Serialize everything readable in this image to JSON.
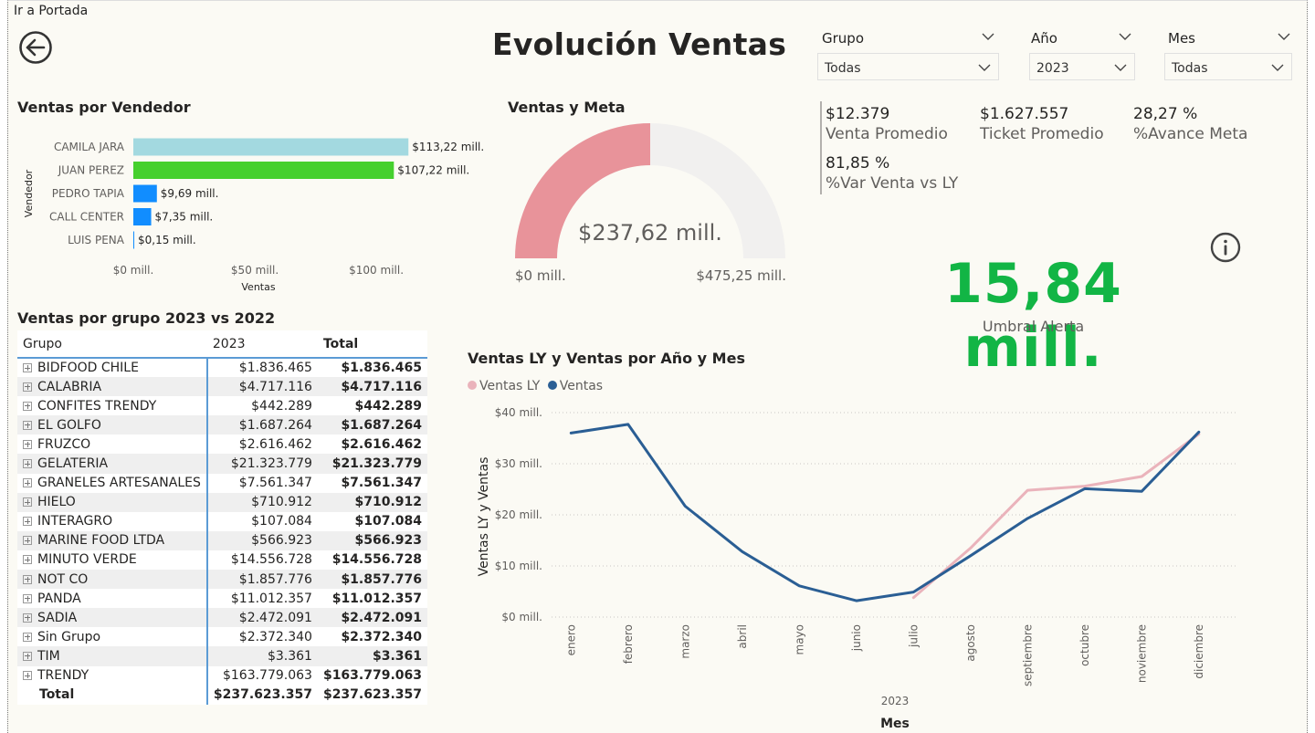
{
  "nav": {
    "portada_label": "Ir a Portada"
  },
  "page": {
    "title": "Evolución Ventas"
  },
  "slicers": [
    {
      "label": "Grupo",
      "value": "Todas"
    },
    {
      "label": "Año",
      "value": "2023"
    },
    {
      "label": "Mes",
      "value": "Todas"
    }
  ],
  "kpis": [
    {
      "value": "$12.379",
      "label": "Venta Promedio"
    },
    {
      "value": "$1.627.557",
      "label": "Ticket Promedio"
    },
    {
      "value": "28,27 %",
      "label": "%Avance Meta"
    },
    {
      "value": "81,85 %",
      "label": "%Var Venta vs LY"
    }
  ],
  "alert": {
    "value": "15,84 mill.",
    "label": "Umbral Alerta"
  },
  "colors": {
    "accent_green": "#12b545",
    "gauge_fill": "#e8939a",
    "gauge_bg": "#f1f0ef",
    "line_ventas": "#2a5e94",
    "line_ly": "#eab3bb"
  },
  "chart_data": [
    {
      "type": "bar",
      "orientation": "horizontal",
      "title": "Ventas por Vendedor",
      "xlabel": "Ventas",
      "ylabel": "Vendedor",
      "categories": [
        "CAMILA JARA",
        "JUAN PEREZ",
        "PEDRO TAPIA",
        "CALL CENTER",
        "LUIS PENA"
      ],
      "values": [
        113.22,
        107.22,
        9.69,
        7.35,
        0.15
      ],
      "data_labels": [
        "$113,22 mill.",
        "$107,22 mill.",
        "$9,69 mill.",
        "$7,35 mill.",
        "$0,15 mill."
      ],
      "bar_colors": [
        "#a3d9e0",
        "#45d02e",
        "#118dff",
        "#118dff",
        "#118dff"
      ],
      "xticks": [
        0,
        50,
        100
      ],
      "xtick_labels": [
        "$0 mill.",
        "$50 mill.",
        "$100 mill."
      ],
      "xlim": [
        0,
        115
      ]
    },
    {
      "type": "gauge",
      "title": "Ventas y Meta",
      "value": 237.62,
      "min": 0,
      "max": 475.25,
      "value_label": "$237,62 mill.",
      "min_label": "$0 mill.",
      "max_label": "$475,25 mill."
    },
    {
      "type": "line",
      "title": "Ventas LY y Ventas por Año y Mes",
      "xlabel": "Mes",
      "x_group_label": "2023",
      "ylabel": "Ventas LY y Ventas",
      "x": [
        "enero",
        "febrero",
        "marzo",
        "abril",
        "mayo",
        "junio",
        "julio",
        "agosto",
        "septiembre",
        "octubre",
        "noviembre",
        "diciembre"
      ],
      "yticks": [
        0,
        10,
        20,
        30,
        40
      ],
      "ytick_labels": [
        "$0 mill.",
        "$10 mill.",
        "$20 mill.",
        "$30 mill.",
        "$40 mill."
      ],
      "ylim": [
        0,
        40
      ],
      "legend": "top-left",
      "series": [
        {
          "name": "Ventas LY",
          "values": [
            null,
            null,
            null,
            null,
            null,
            null,
            3.8,
            13.5,
            24.8,
            25.6,
            27.5,
            35.8
          ]
        },
        {
          "name": "Ventas",
          "values": [
            36,
            37.7,
            21.7,
            12.8,
            6.1,
            3.2,
            4.9,
            12,
            19.3,
            25.1,
            24.6,
            36.2
          ]
        }
      ]
    },
    {
      "type": "table",
      "title": "Ventas por grupo 2023 vs 2022",
      "columns": [
        "Grupo",
        "2023",
        "Total"
      ],
      "rows": [
        [
          "BIDFOOD CHILE",
          "$1.836.465",
          "$1.836.465"
        ],
        [
          "CALABRIA",
          "$4.717.116",
          "$4.717.116"
        ],
        [
          "CONFITES TRENDY",
          "$442.289",
          "$442.289"
        ],
        [
          "EL GOLFO",
          "$1.687.264",
          "$1.687.264"
        ],
        [
          "FRUZCO",
          "$2.616.462",
          "$2.616.462"
        ],
        [
          "GELATERIA",
          "$21.323.779",
          "$21.323.779"
        ],
        [
          "GRANELES ARTESANALES",
          "$7.561.347",
          "$7.561.347"
        ],
        [
          "HIELO",
          "$710.912",
          "$710.912"
        ],
        [
          "INTERAGRO",
          "$107.084",
          "$107.084"
        ],
        [
          "MARINE FOOD LTDA",
          "$566.923",
          "$566.923"
        ],
        [
          "MINUTO VERDE",
          "$14.556.728",
          "$14.556.728"
        ],
        [
          "NOT CO",
          "$1.857.776",
          "$1.857.776"
        ],
        [
          "PANDA",
          "$11.012.357",
          "$11.012.357"
        ],
        [
          "SADIA",
          "$2.472.091",
          "$2.472.091"
        ],
        [
          "Sin Grupo",
          "$2.372.340",
          "$2.372.340"
        ],
        [
          "TIM",
          "$3.361",
          "$3.361"
        ],
        [
          "TRENDY",
          "$163.779.063",
          "$163.779.063"
        ]
      ],
      "total": [
        "Total",
        "$237.623.357",
        "$237.623.357"
      ]
    }
  ]
}
